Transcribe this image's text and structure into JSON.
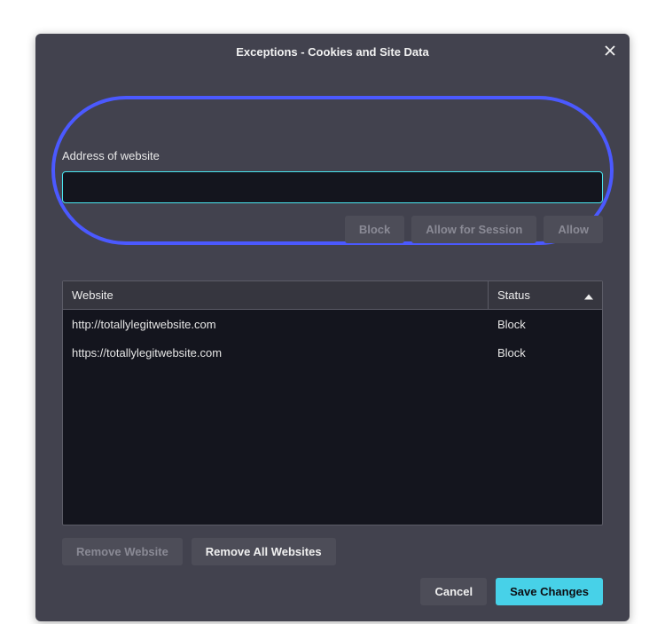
{
  "title": "Exceptions - Cookies and Site Data",
  "input": {
    "label": "Address of website",
    "value": "",
    "placeholder": ""
  },
  "input_actions": {
    "block": "Block",
    "allow_session": "Allow for Session",
    "allow": "Allow"
  },
  "table": {
    "headers": {
      "website": "Website",
      "status": "Status"
    },
    "rows": [
      {
        "website": "http://totallylegitwebsite.com",
        "status": "Block"
      },
      {
        "website": "https://totallylegitwebsite.com",
        "status": "Block"
      }
    ]
  },
  "remove_actions": {
    "remove_one": "Remove Website",
    "remove_all": "Remove All Websites"
  },
  "footer_actions": {
    "cancel": "Cancel",
    "save": "Save Changes"
  }
}
